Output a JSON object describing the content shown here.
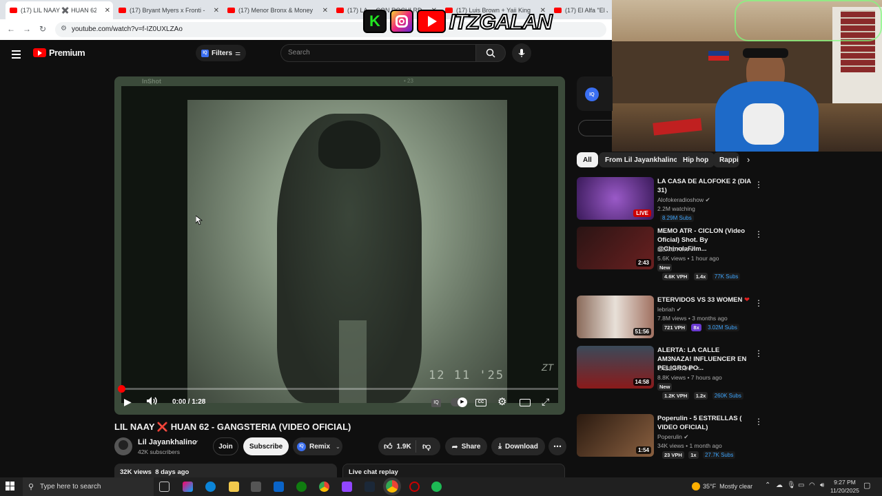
{
  "browser": {
    "tabs": [
      {
        "label": "(17) LIL NAAY ✖️ HUAN 62 - G",
        "active": true
      },
      {
        "label": "(17) Bryant Myers x Fronti - GO"
      },
      {
        "label": "(17) Menor Bronx & Money Jur"
      },
      {
        "label": "(17) LA ... CON ROCHI RD"
      },
      {
        "label": "(17) Luis Brown + Yaii King - IT"
      },
      {
        "label": "(17) El Alfa \"El Jefe"
      }
    ],
    "url": "youtube.com/watch?v=f-IZ0UXLZAo"
  },
  "overlay": {
    "name": "ITZGALAN",
    "k_letter": "K"
  },
  "youtube": {
    "brand": "Premium",
    "filters_label": "Filters",
    "iq_label": "IQ",
    "search_placeholder": "Search"
  },
  "player": {
    "watermark_top": "InShot",
    "watermark_right": "• 23",
    "timestamp_overlay": "12 11 '25",
    "corner_logo": "ZT",
    "time": "0:00 / 1:28",
    "progress": 0.003
  },
  "video": {
    "title": "LIL NAAY ❌ HUAN 62 - GANGSTERIA (VIDEO OFICIAL)",
    "channel": "Lil Jayankhalino",
    "subscribers": "42K subscribers",
    "join_label": "Join",
    "subscribe_label": "Subscribe",
    "remix_label": "Remix",
    "likes": "1.9K",
    "share_label": "Share",
    "download_label": "Download",
    "views_date": "32K views  8 days ago",
    "live_chat_label": "Live chat replay"
  },
  "chips": [
    {
      "label": "All",
      "selected": true
    },
    {
      "label": "From Lil Jayankhalino"
    },
    {
      "label": "Hip hop"
    },
    {
      "label": "Rappi"
    }
  ],
  "recommendations": [
    {
      "title": "LA CASA DE ALOFOKE 2 (DIA 31)",
      "channel": "Alofokeradioshow",
      "meta": "2.2M watching",
      "subs": "8.29M Subs",
      "badge": "LIVE",
      "thumb_color": "#4a2a6a"
    },
    {
      "title": "MEMO ATR -  CICLON (Video Oficial) Shot. By @ChinolaFilm...",
      "channel": "MEMO ATR",
      "meta": "5.6K views • 1 hour ago",
      "new": "New",
      "vph": "4.6K VPH",
      "mult": "1.4x",
      "subs": "77K Subs",
      "duration": "2:43",
      "thumb_color": "#3a1a1a"
    },
    {
      "title": "ETERVIDOS VS 33 WOMEN",
      "channel": "lebriah",
      "meta": "7.8M views • 3 months ago",
      "vph": "721 VPH",
      "mult": "8x",
      "subs": "3.02M Subs",
      "duration": "51:56",
      "thumb_color": "#6a4a3a",
      "heart": "❤"
    },
    {
      "title": "ALERTA: LA CALLE AM3NAZA! INFLUENCER EN PELIGRO PO...",
      "channel": "TASER TRAP",
      "meta": "8.8K views • 7 hours ago",
      "new": "New",
      "vph": "1.2K VPH",
      "mult": "1.2x",
      "subs": "260K Subs",
      "duration": "14:58",
      "thumb_color": "#7a1a1a"
    },
    {
      "title": "Poperulin - 5 ESTRELLAS ( VIDEO OFICIAL)",
      "channel": "Poperulin",
      "meta": "34K views • 1 month ago",
      "vph": "23 VPH",
      "mult": "1x",
      "subs": "27.7K Subs",
      "duration": "1:54",
      "thumb_color": "#5a3a2a"
    }
  ],
  "taskbar": {
    "search_placeholder": "Type here to search",
    "weather": "35°F  Mostly clear",
    "time": "9:27 PM",
    "date": "11/20/2025"
  },
  "colors": {
    "accent_red": "#ff0000",
    "link_blue": "#3ea6ff",
    "bg": "#0f0f0f"
  }
}
